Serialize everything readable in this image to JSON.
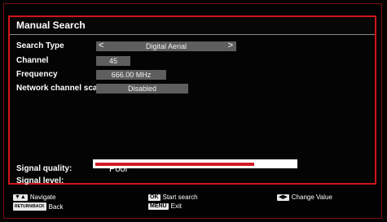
{
  "dialog": {
    "title": "Manual Search",
    "rows": [
      {
        "label": "Search Type",
        "value": "Digital Aerial"
      },
      {
        "label": "Channel",
        "value": "45"
      },
      {
        "label": "Frequency",
        "value": "666.00 MHz"
      },
      {
        "label": "Network channel scan",
        "value": "Disabled"
      }
    ],
    "arrow_left": "<",
    "arrow_right": ">",
    "signal_quality_label": "Signal quality:",
    "signal_quality_value": "Poor",
    "signal_level_label": "Signal level:",
    "signal_level_fraction": 0.87
  },
  "footer": {
    "navigate": {
      "keys": "▼▲",
      "label": "Navigate"
    },
    "back": {
      "keys": "RETURN/BACK",
      "label": "Back"
    },
    "start_search": {
      "keys": "OK",
      "label": "Start search"
    },
    "exit": {
      "keys": "MENU",
      "label": "Exit"
    },
    "change_value": {
      "keys": "◀▶",
      "label": "Change Value"
    }
  },
  "colors": {
    "frame_red": "#d0141c",
    "value_box_grey": "#5e5e5e",
    "signal_bar_red": "#d21a24"
  }
}
